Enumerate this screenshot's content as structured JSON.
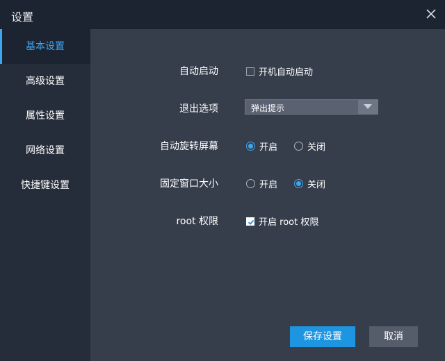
{
  "window": {
    "title": "设置"
  },
  "sidebar": {
    "items": [
      {
        "label": "基本设置",
        "active": true
      },
      {
        "label": "高级设置",
        "active": false
      },
      {
        "label": "属性设置",
        "active": false
      },
      {
        "label": "网络设置",
        "active": false
      },
      {
        "label": "快捷键设置",
        "active": false
      }
    ]
  },
  "settings": {
    "autostart": {
      "label": "自动启动",
      "option": "开机自动启动",
      "checked": false
    },
    "exit": {
      "label": "退出选项",
      "value": "弹出提示"
    },
    "rotate": {
      "label": "自动旋转屏幕",
      "on": "开启",
      "off": "关闭",
      "selected": "on"
    },
    "fixed_size": {
      "label": "固定窗口大小",
      "on": "开启",
      "off": "关闭",
      "selected": "off"
    },
    "root": {
      "label": "root 权限",
      "option": "开启 root 权限",
      "checked": true
    }
  },
  "footer": {
    "save_label": "保存设置",
    "cancel_label": "取消"
  },
  "colors": {
    "accent": "#3ea6f0",
    "primary_button": "#1e95e0"
  }
}
